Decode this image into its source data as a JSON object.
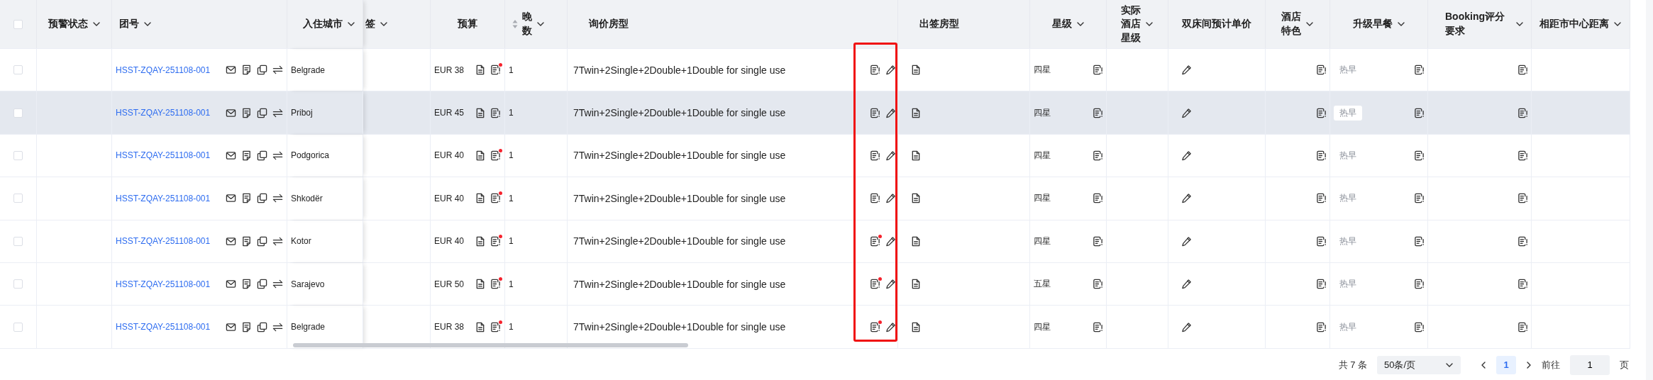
{
  "table": {
    "header_checkbox": {
      "checked": false
    },
    "columns": [
      {
        "kind": "checkbox"
      },
      {
        "label": "预警状态",
        "kind": "empty",
        "filter": true
      },
      {
        "label": "团号",
        "kind": "group_no",
        "filter": true
      },
      {
        "label": "入住城市",
        "kind": "city",
        "filter": true
      },
      {
        "label": "签",
        "kind": "empty",
        "filter": true
      },
      {
        "label": "预算",
        "kind": "budget",
        "filter": false
      },
      {
        "label": "晚数",
        "kind": "nights",
        "filter": true,
        "sortable": true
      },
      {
        "label": "询价房型",
        "kind": "room",
        "filter": false
      },
      {
        "label": "出签房型",
        "kind": "issued",
        "filter": false
      },
      {
        "label": "星级",
        "kind": "star",
        "filter": true
      },
      {
        "label": "实际酒店星级",
        "kind": "empty",
        "filter": true
      },
      {
        "label": "双床间预计单价",
        "kind": "pencil",
        "filter": false
      },
      {
        "label": "酒店特色",
        "kind": "note",
        "filter": true
      },
      {
        "label": "升级早餐",
        "kind": "breakfast",
        "filter": true
      },
      {
        "label": "Booking评分要求",
        "kind": "note",
        "filter": true
      },
      {
        "label": "相距市中心距离",
        "kind": "empty",
        "filter": true
      }
    ],
    "rows": [
      {
        "checked": false,
        "hovered": false,
        "group_no": "HSST-ZQAY-251108-001",
        "city": "Belgrade",
        "budget": "EUR 38",
        "budget_flag": true,
        "nights": "1",
        "room": "7Twin+2Single+2Double+1Double for single use",
        "room_flag": false,
        "star": "四星",
        "breakfast": "热早"
      },
      {
        "checked": false,
        "hovered": true,
        "group_no": "HSST-ZQAY-251108-001",
        "city": "Priboj",
        "budget": "EUR 45",
        "budget_flag": false,
        "nights": "1",
        "room": "7Twin+2Single+2Double+1Double for single use",
        "room_flag": false,
        "star": "四星",
        "breakfast": "热早"
      },
      {
        "checked": false,
        "hovered": false,
        "group_no": "HSST-ZQAY-251108-001",
        "city": "Podgorica",
        "budget": "EUR 40",
        "budget_flag": true,
        "nights": "1",
        "room": "7Twin+2Single+2Double+1Double for single use",
        "room_flag": false,
        "star": "四星",
        "breakfast": "热早"
      },
      {
        "checked": false,
        "hovered": false,
        "group_no": "HSST-ZQAY-251108-001",
        "city": "Shkodër",
        "budget": "EUR 40",
        "budget_flag": true,
        "nights": "1",
        "room": "7Twin+2Single+2Double+1Double for single use",
        "room_flag": false,
        "star": "四星",
        "breakfast": "热早"
      },
      {
        "checked": false,
        "hovered": false,
        "group_no": "HSST-ZQAY-251108-001",
        "city": "Kotor",
        "budget": "EUR 40",
        "budget_flag": true,
        "nights": "1",
        "room": "7Twin+2Single+2Double+1Double for single use",
        "room_flag": true,
        "star": "四星",
        "breakfast": "热早"
      },
      {
        "checked": false,
        "hovered": false,
        "group_no": "HSST-ZQAY-251108-001",
        "city": "Sarajevo",
        "budget": "EUR 50",
        "budget_flag": true,
        "nights": "1",
        "room": "7Twin+2Single+2Double+1Double for single use",
        "room_flag": true,
        "star": "五星",
        "breakfast": "热早"
      },
      {
        "checked": false,
        "hovered": false,
        "group_no": "HSST-ZQAY-251108-001",
        "city": "Belgrade",
        "budget": "EUR 38",
        "budget_flag": true,
        "nights": "1",
        "room": "7Twin+2Single+2Double+1Double for single use",
        "room_flag": true,
        "star": "四星",
        "breakfast": "热早"
      }
    ],
    "annotation": {
      "kind": "rectangle"
    }
  },
  "pagination": {
    "total": "共 7 条",
    "page_size": "50条/页",
    "pages": [
      {
        "label": "1",
        "selected": true
      }
    ],
    "goto_label": "前往",
    "goto_value": "1",
    "goto_suffix": "页"
  }
}
